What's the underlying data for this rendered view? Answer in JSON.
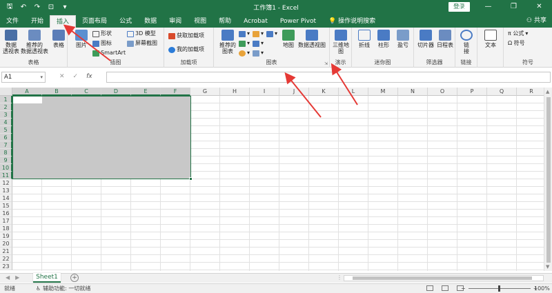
{
  "titlebar": {
    "title": "工作簿1 - Excel",
    "login": "登录",
    "qat": [
      "save-icon",
      "undo-icon",
      "redo-icon",
      "touch-mode-icon",
      "customize-icon"
    ]
  },
  "tabs": [
    {
      "label": "文件"
    },
    {
      "label": "开始"
    },
    {
      "label": "插入"
    },
    {
      "label": "页面布局"
    },
    {
      "label": "公式"
    },
    {
      "label": "数据"
    },
    {
      "label": "审阅"
    },
    {
      "label": "视图"
    },
    {
      "label": "帮助"
    },
    {
      "label": "Acrobat"
    },
    {
      "label": "Power Pivot"
    },
    {
      "label": "操作说明搜索"
    }
  ],
  "share": "共享",
  "ribbon": {
    "tables": {
      "group": "表格",
      "pivot": "数据\n透视表",
      "recommended_pivot": "推荐的\n数据透视表",
      "table": "表格"
    },
    "illustrations": {
      "group": "插图",
      "pictures": "图片",
      "shapes": "形状",
      "icons": "图标",
      "model3d": "3D 模型",
      "smartart": "SmartArt",
      "screenshot": "屏幕截图"
    },
    "addins": {
      "group": "加载项",
      "get": "获取加载项",
      "mine": "我的加载项"
    },
    "charts": {
      "group": "图表",
      "recommended": "推荐的\n图表",
      "map": "地图",
      "pivotchart": "数据透视图"
    },
    "tours": {
      "group": "演示",
      "map3d": "三维地\n图"
    },
    "sparklines": {
      "group": "迷你图",
      "line": "折线",
      "column": "柱形",
      "winloss": "盈亏"
    },
    "filters": {
      "group": "筛选器",
      "slicer": "切片器",
      "timeline": "日程表"
    },
    "links": {
      "group": "链接",
      "link": "链\n接"
    },
    "text": {
      "group": "",
      "text": "文本"
    },
    "symbols": {
      "group": "符号",
      "equation": "π 公式",
      "symbol": "Ω 符号"
    }
  },
  "formula_bar": {
    "namebox": "A1",
    "cancel": "✕",
    "enter": "✓",
    "fx": "fx",
    "value": ""
  },
  "columns": [
    "A",
    "B",
    "C",
    "D",
    "E",
    "F",
    "G",
    "H",
    "I",
    "J",
    "K",
    "L",
    "M",
    "N",
    "O",
    "P",
    "Q",
    "R"
  ],
  "rows": [
    "1",
    "2",
    "3",
    "4",
    "5",
    "6",
    "7",
    "8",
    "9",
    "10",
    "11",
    "12",
    "13",
    "14",
    "15",
    "16",
    "17",
    "18",
    "19",
    "20",
    "21",
    "22",
    "23"
  ],
  "selection": {
    "range": "A1:F11",
    "active_cell": "A1"
  },
  "sheets": [
    {
      "name": "Sheet1",
      "active": true
    }
  ],
  "status": {
    "ready": "就绪",
    "accessibility": "辅助功能: 一切就绪",
    "zoom": "100%"
  },
  "colors": {
    "excel_green": "#217346",
    "selection_fill": "#c8c8c8",
    "arrow_red": "#e53935"
  }
}
